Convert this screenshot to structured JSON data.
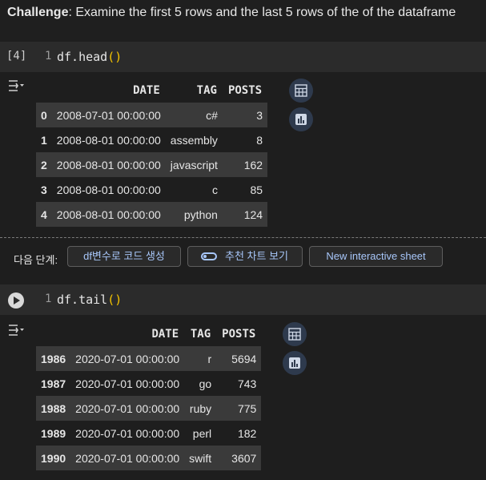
{
  "challenge": {
    "label": "Challenge",
    "text": ": Examine the first 5 rows and the last 5 rows of the of the dataframe"
  },
  "cell1": {
    "exec_count": "[4]",
    "line_no": "1",
    "code_name": "df.head",
    "code_parens": "()",
    "output": {
      "columns": [
        "",
        "DATE",
        "TAG",
        "POSTS"
      ],
      "rows": [
        {
          "index": "0",
          "date": "2008-07-01 00:00:00",
          "tag": "c#",
          "posts": "3"
        },
        {
          "index": "1",
          "date": "2008-08-01 00:00:00",
          "tag": "assembly",
          "posts": "8"
        },
        {
          "index": "2",
          "date": "2008-08-01 00:00:00",
          "tag": "javascript",
          "posts": "162"
        },
        {
          "index": "3",
          "date": "2008-08-01 00:00:00",
          "tag": "c",
          "posts": "85"
        },
        {
          "index": "4",
          "date": "2008-08-01 00:00:00",
          "tag": "python",
          "posts": "124"
        }
      ]
    }
  },
  "next_steps": {
    "label": "다음 단계:",
    "buttons": [
      "df변수로 코드 생성",
      "추천 차트 보기",
      "New interactive sheet"
    ]
  },
  "cell2": {
    "line_no": "1",
    "code_name": "df.tail",
    "code_parens": "()",
    "output": {
      "columns": [
        "",
        "DATE",
        "TAG",
        "POSTS"
      ],
      "rows": [
        {
          "index": "1986",
          "date": "2020-07-01 00:00:00",
          "tag": "r",
          "posts": "5694"
        },
        {
          "index": "1987",
          "date": "2020-07-01 00:00:00",
          "tag": "go",
          "posts": "743"
        },
        {
          "index": "1988",
          "date": "2020-07-01 00:00:00",
          "tag": "ruby",
          "posts": "775"
        },
        {
          "index": "1989",
          "date": "2020-07-01 00:00:00",
          "tag": "perl",
          "posts": "182"
        },
        {
          "index": "1990",
          "date": "2020-07-01 00:00:00",
          "tag": "swift",
          "posts": "3607"
        }
      ]
    }
  },
  "icons": {
    "output_toggle": "output-settings-icon",
    "table_view": "table-icon",
    "chart_suggest": "bar-chart-icon",
    "run": "play-icon",
    "toggle": "toggle-icon"
  },
  "colors": {
    "background": "#1e1e1e",
    "cell_bg": "#2b2b2b",
    "paren": "#f5c400",
    "accent": "#a8c7fa",
    "row_stripe": "#3a3a3a"
  }
}
